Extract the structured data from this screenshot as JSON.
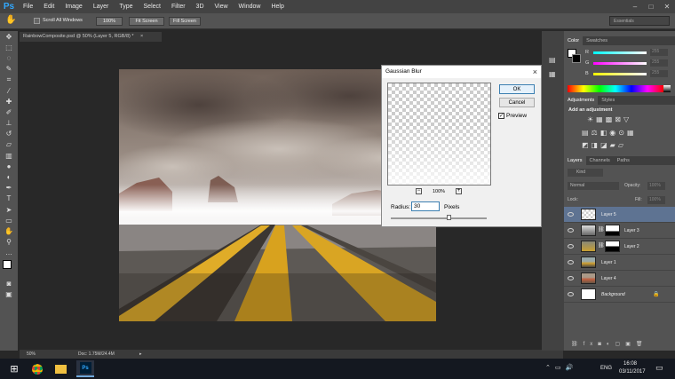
{
  "app": {
    "logo": "Ps",
    "menu": [
      "File",
      "Edit",
      "Image",
      "Layer",
      "Type",
      "Select",
      "Filter",
      "3D",
      "View",
      "Window",
      "Help"
    ]
  },
  "options": {
    "scroll_all_windows": "Scroll All Windows",
    "zoom_100": "100%",
    "fit_screen": "Fit Screen",
    "fill_screen": "Fill Screen",
    "workspace": "Essentials"
  },
  "document": {
    "tab_title": "RainbowComposite.psd @ 50% (Layer 5, RGB/8) *",
    "zoom": "50%",
    "doc_info": "Doc: 1.75M/24.4M"
  },
  "dialog": {
    "title": "Gaussian Blur",
    "ok": "OK",
    "cancel": "Cancel",
    "preview": "Preview",
    "preview_zoom": "100%",
    "radius_label": "Radius:",
    "radius_value": "30",
    "radius_unit": "Pixels",
    "radius_slider": 0.6
  },
  "color_panel": {
    "tabs": [
      "Color",
      "Swatches"
    ],
    "channels": [
      {
        "name": "R",
        "value": "255"
      },
      {
        "name": "G",
        "value": "255"
      },
      {
        "name": "B",
        "value": "255"
      }
    ]
  },
  "adjustments_panel": {
    "tabs": [
      "Adjustments",
      "Styles"
    ],
    "heading": "Add an adjustment"
  },
  "layers_panel": {
    "tabs": [
      "Layers",
      "Channels",
      "Paths"
    ],
    "kind": "Kind",
    "blend": "Normal",
    "opacity_label": "Opacity:",
    "opacity": "100%",
    "lock_label": "Lock:",
    "fill_label": "Fill:",
    "fill": "100%",
    "layers": [
      {
        "name": "Layer 5",
        "selected": true
      },
      {
        "name": "Layer 3",
        "selected": false
      },
      {
        "name": "Layer 2",
        "selected": false
      },
      {
        "name": "Layer 1",
        "selected": false
      },
      {
        "name": "Layer 4",
        "selected": false
      },
      {
        "name": "Background",
        "selected": false
      }
    ]
  },
  "taskbar": {
    "lang": "ENG",
    "time": "16:08",
    "date": "03/11/2017"
  },
  "colors": {
    "accent": "#31a8ff",
    "layer_selected": "#5e7392",
    "road_yellow": "#e8b42a"
  }
}
